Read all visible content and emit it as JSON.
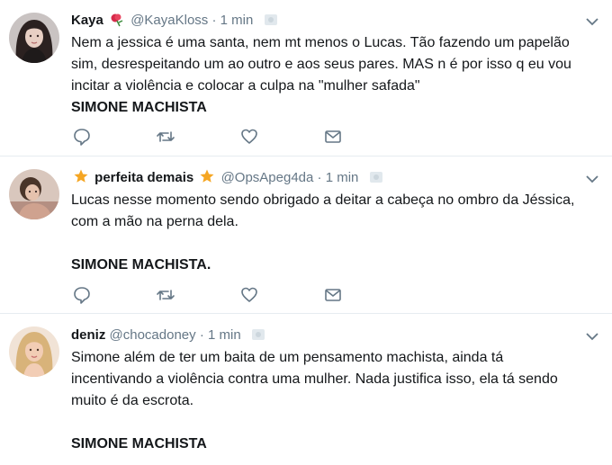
{
  "tweets": [
    {
      "name": "Kaya",
      "emoji": "rose",
      "username": "@KayaKloss",
      "separator": "·",
      "time": "1 min",
      "lines": [
        "Nem a jessica é uma santa, nem mt menos o Lucas. Tão fazendo um papelão",
        "sim, desrespeitando um ao outro e aos seus pares. MAS n é por isso q eu vou",
        "incitar a violência e colocar a culpa na \"mulher safada\""
      ],
      "bold": "SIMONE MACHISTA"
    },
    {
      "name": "perfeita demais",
      "emoji": "star",
      "username": "@OpsApeg4da",
      "separator": "·",
      "time": "1 min",
      "lines": [
        "Lucas nesse momento sendo obrigado a deitar a cabeça no ombro da Jéssica,",
        "com a mão na perna dela."
      ],
      "bold": "SIMONE MACHISTA."
    },
    {
      "name": "deniz",
      "username": "@chocadoney",
      "separator": "·",
      "time": "1 min",
      "lines": [
        "Simone além de ter um baita de um pensamento machista, ainda tá",
        "incentivando a violência contra uma mulher. Nada justifica isso, ela tá sendo",
        "muito é da escrota."
      ],
      "bold": "SIMONE MACHISTA"
    }
  ],
  "icons": {
    "reply": "reply-icon",
    "retweet": "retweet-icon",
    "like": "like-icon",
    "dm": "direct-message-icon",
    "caret": "chevron-down-icon"
  },
  "colors": {
    "text": "#14171a",
    "secondary": "#657786",
    "icon": "#657786",
    "divider": "#e6ecf0",
    "star": "#f5a623",
    "rose": "#d62a4a"
  }
}
